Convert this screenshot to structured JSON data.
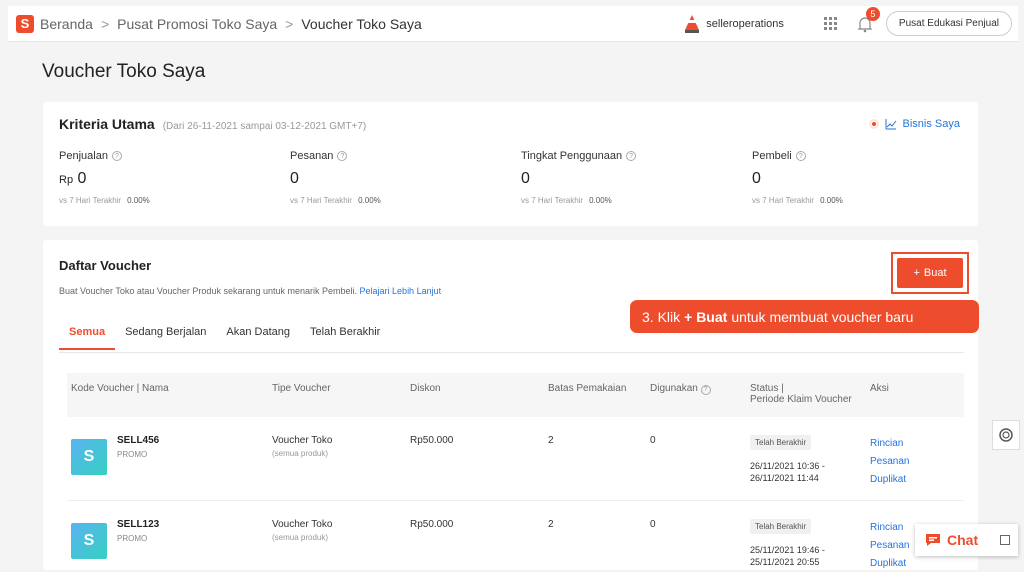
{
  "breadcrumb": {
    "items": [
      "Beranda",
      "Pusat Promosi Toko Saya",
      "Voucher Toko Saya"
    ],
    "separator": ">"
  },
  "header": {
    "username": "selleroperations",
    "notification_count": "5",
    "edu_button": "Pusat Edukasi Penjual"
  },
  "page_title": "Voucher Toko Saya",
  "kriteria": {
    "title": "Kriteria Utama",
    "range": "(Dari 26-11-2021 sampai 03-12-2021 GMT+7)",
    "bisnis_link": "Bisnis Saya",
    "metrics": [
      {
        "label": "Penjualan",
        "currency": "Rp",
        "value": "0",
        "compare_label": "vs 7 Hari Terakhir",
        "compare_value": "0.00%"
      },
      {
        "label": "Pesanan",
        "currency": "",
        "value": "0",
        "compare_label": "vs 7 Hari Terakhir",
        "compare_value": "0.00%"
      },
      {
        "label": "Tingkat Penggunaan",
        "currency": "",
        "value": "0",
        "compare_label": "vs 7 Hari Terakhir",
        "compare_value": "0.00%"
      },
      {
        "label": "Pembeli",
        "currency": "",
        "value": "0",
        "compare_label": "vs 7 Hari Terakhir",
        "compare_value": "0.00%"
      }
    ]
  },
  "voucher_list": {
    "title": "Daftar Voucher",
    "description": "Buat Voucher Toko atau Voucher Produk sekarang untuk menarik Pembeli.",
    "learn_more": "Pelajari Lebih Lanjut",
    "create_button": "Buat",
    "tooltip": {
      "prefix": "3. Klik",
      "bold": "+ Buat",
      "suffix": "untuk membuat voucher baru"
    },
    "tabs": [
      "Semua",
      "Sedang Berjalan",
      "Akan Datang",
      "Telah Berakhir"
    ],
    "columns": [
      "Kode Voucher | Nama",
      "Tipe Voucher",
      "Diskon",
      "Batas Pemakaian",
      "Digunakan",
      "Status |",
      "Periode Klaim Voucher",
      "Aksi"
    ],
    "rows": [
      {
        "code": "SELL456",
        "name": "PROMO",
        "type": "Voucher Toko",
        "scope": "(semua produk)",
        "discount": "Rp50.000",
        "limit": "2",
        "used": "0",
        "status": "Telah Berakhir",
        "period_start": "26/11/2021 10:36 -",
        "period_end": "26/11/2021 11:44",
        "actions": [
          "Rincian",
          "Pesanan",
          "Duplikat"
        ]
      },
      {
        "code": "SELL123",
        "name": "PROMO",
        "type": "Voucher Toko",
        "scope": "(semua produk)",
        "discount": "Rp50.000",
        "limit": "2",
        "used": "0",
        "status": "Telah Berakhir",
        "period_start": "25/11/2021 19:46 -",
        "period_end": "25/11/2021 20:55",
        "actions": [
          "Rincian",
          "Pesanan",
          "Duplikat"
        ]
      }
    ]
  },
  "chat": {
    "label": "Chat"
  },
  "colors": {
    "brand": "#ee4d2d",
    "link": "#2673dd"
  }
}
